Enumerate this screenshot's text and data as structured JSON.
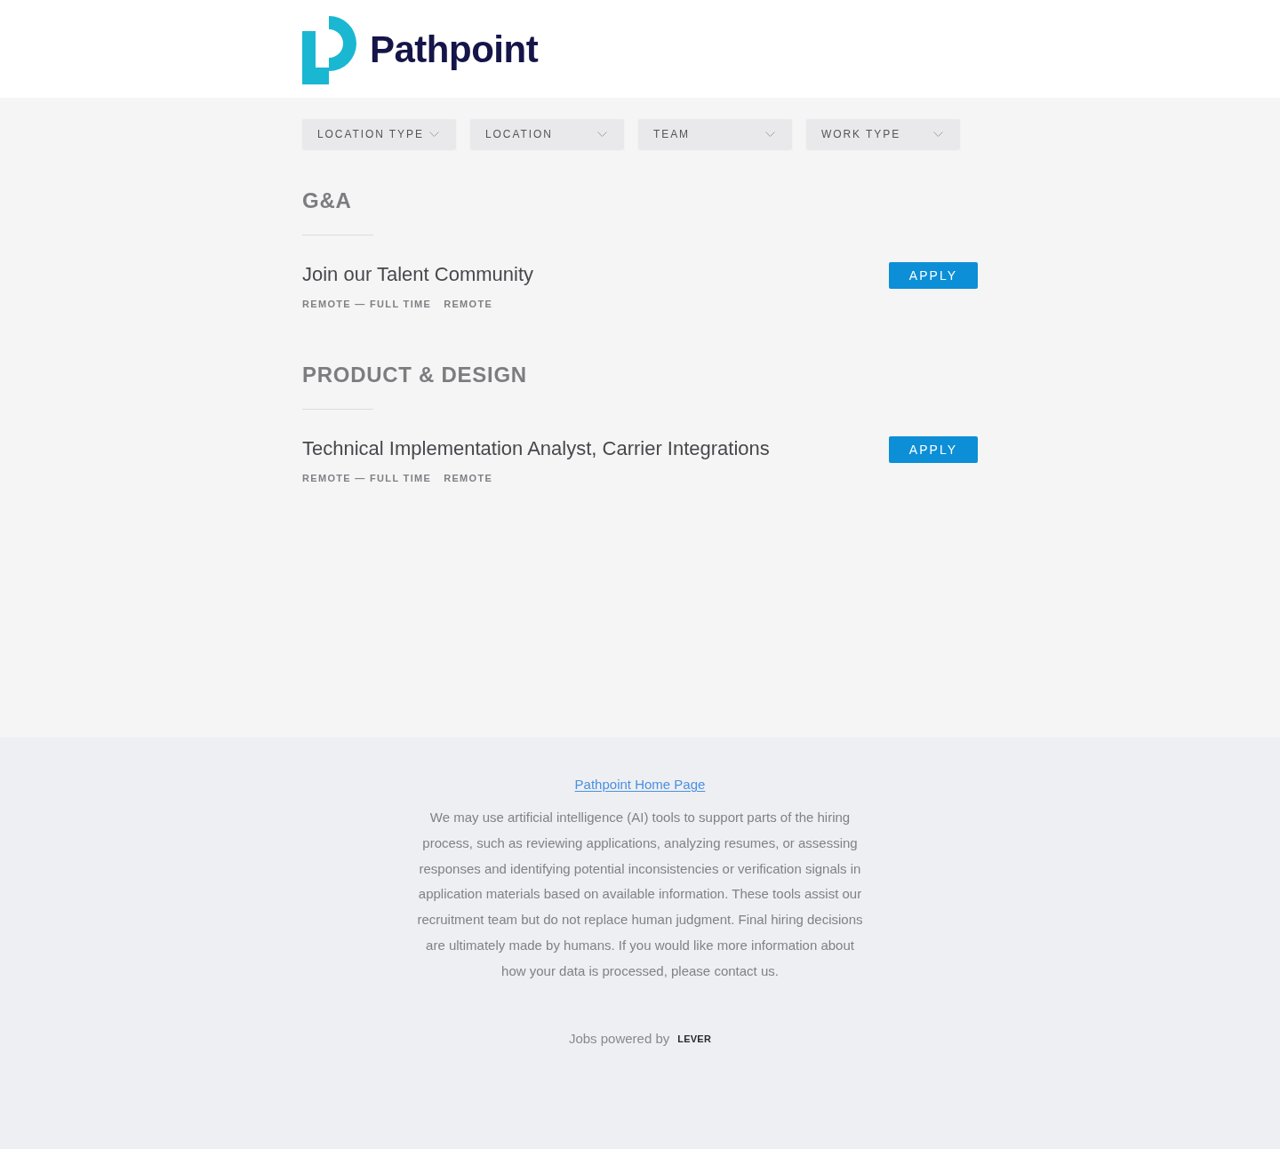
{
  "header": {
    "logo_text": "Pathpoint"
  },
  "filters": [
    "LOCATION TYPE",
    "LOCATION",
    "TEAM",
    "WORK TYPE"
  ],
  "groups": [
    {
      "title": "G&A",
      "postings": [
        {
          "title": "Join our Talent Community",
          "meta": [
            "REMOTE — FULL TIME",
            "REMOTE"
          ],
          "button": "APPLY"
        }
      ]
    },
    {
      "title": "PRODUCT & DESIGN",
      "postings": [
        {
          "title": "Technical Implementation Analyst, Carrier Integrations",
          "meta": [
            "REMOTE — FULL TIME",
            "REMOTE"
          ],
          "button": "APPLY"
        }
      ]
    }
  ],
  "footer": {
    "link": "Pathpoint Home Page",
    "disclaimer": "We may use artificial intelligence (AI) tools to support parts of the hiring process, such as reviewing applications, analyzing resumes, or assessing responses and identifying potential inconsistencies or verification signals in application materials based on available information. These tools assist our recruitment team but do not replace human judgment. Final hiring decisions are ultimately made by humans. If you would like more information about how your data is processed, please contact us.",
    "powered_by": "Jobs powered by",
    "powered_logo": "LEVER"
  }
}
